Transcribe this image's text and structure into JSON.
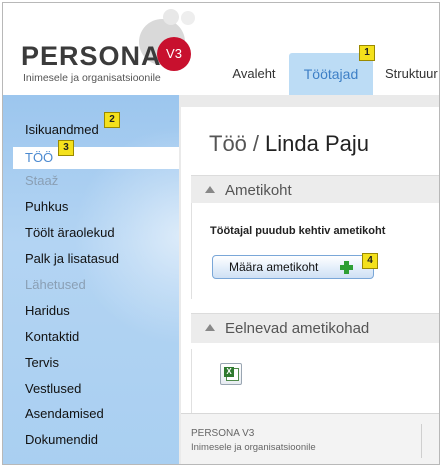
{
  "logo": {
    "wordmark": "PERSONA",
    "version": "V3",
    "tagline": "Inimesele ja organisatsioonile"
  },
  "top_nav": {
    "tabs": [
      {
        "label": "Avaleht",
        "active": false
      },
      {
        "label": "Töötajad",
        "active": true
      },
      {
        "label": "Struktuur",
        "active": false
      }
    ]
  },
  "badges": [
    "1",
    "2",
    "3",
    "4"
  ],
  "sidebar": {
    "items": [
      {
        "label": "Isikuandmed",
        "state": "normal"
      },
      {
        "label": "TÖÖ",
        "state": "selected"
      },
      {
        "label": "Staaž",
        "state": "disabled"
      },
      {
        "label": "Puhkus",
        "state": "normal"
      },
      {
        "label": "Töölt äraolekud",
        "state": "normal"
      },
      {
        "label": "Palk ja lisatasud",
        "state": "normal"
      },
      {
        "label": "Lähetused",
        "state": "disabled"
      },
      {
        "label": "Haridus",
        "state": "normal"
      },
      {
        "label": "Kontaktid",
        "state": "normal"
      },
      {
        "label": "Tervis",
        "state": "normal"
      },
      {
        "label": "Vestlused",
        "state": "normal"
      },
      {
        "label": "Asendamised",
        "state": "normal"
      },
      {
        "label": "Dokumendid",
        "state": "normal"
      }
    ]
  },
  "main": {
    "breadcrumb": "Töö",
    "separator": "/",
    "employee_name": "Linda Paju",
    "current_position": {
      "title": "Ametikoht",
      "message": "Töötajal puudub kehtiv ametikoht",
      "button_label": "Määra ametikoht"
    },
    "previous_positions": {
      "title": "Eelnevad ametikohad",
      "export_icon": "excel-icon"
    }
  },
  "footer": {
    "title": "PERSONA V3",
    "subtitle": "Inimesele ja organisatsioonile"
  },
  "colors": {
    "brand_red": "#c8102e",
    "active_tab_bg": "#bcdcf5",
    "active_tab_text": "#3d7fc6",
    "sidebar_bg": "#a9cff1",
    "selected_item_text": "#4a89d0",
    "badge_yellow": "#f4e11c",
    "plus_green": "#2e9f34"
  }
}
